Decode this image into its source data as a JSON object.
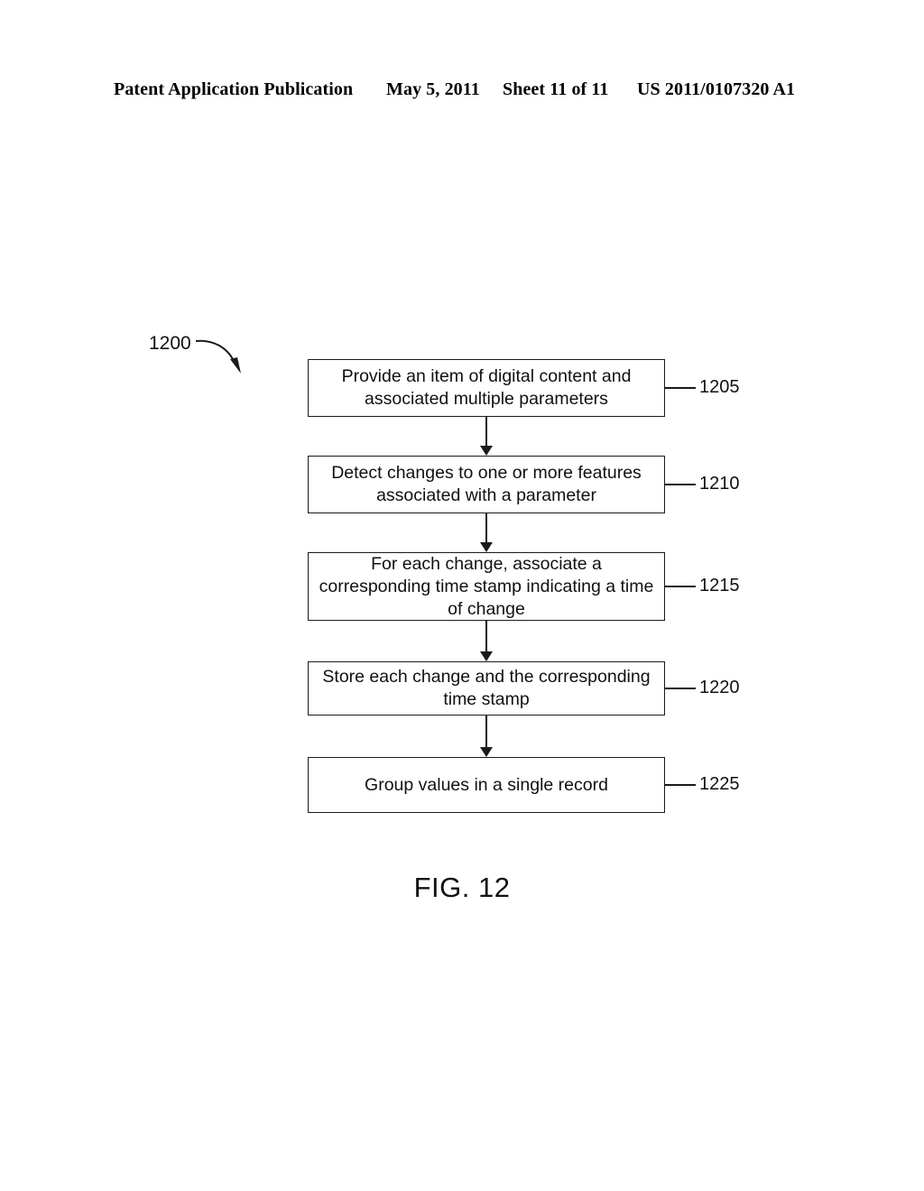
{
  "header": {
    "title": "Patent Application Publication",
    "date": "May 5, 2011",
    "sheet": "Sheet 11 of 11",
    "patent_number": "US 2011/0107320 A1"
  },
  "figure": {
    "caption": "FIG. 12",
    "process_label": "1200"
  },
  "flowchart": {
    "type": "flowchart",
    "orientation": "vertical",
    "steps": [
      {
        "ref": "1205",
        "text": "Provide an item of digital content and associated multiple parameters"
      },
      {
        "ref": "1210",
        "text": "Detect changes to one or more features associated with a parameter"
      },
      {
        "ref": "1215",
        "text": "For each change, associate a corresponding time stamp indicating a time of change"
      },
      {
        "ref": "1220",
        "text": "Store each change and the corresponding time stamp"
      },
      {
        "ref": "1225",
        "text": "Group values in a single record"
      }
    ]
  },
  "colors": {
    "ink": "#111111",
    "line": "#1a1a1a",
    "background": "#ffffff"
  }
}
